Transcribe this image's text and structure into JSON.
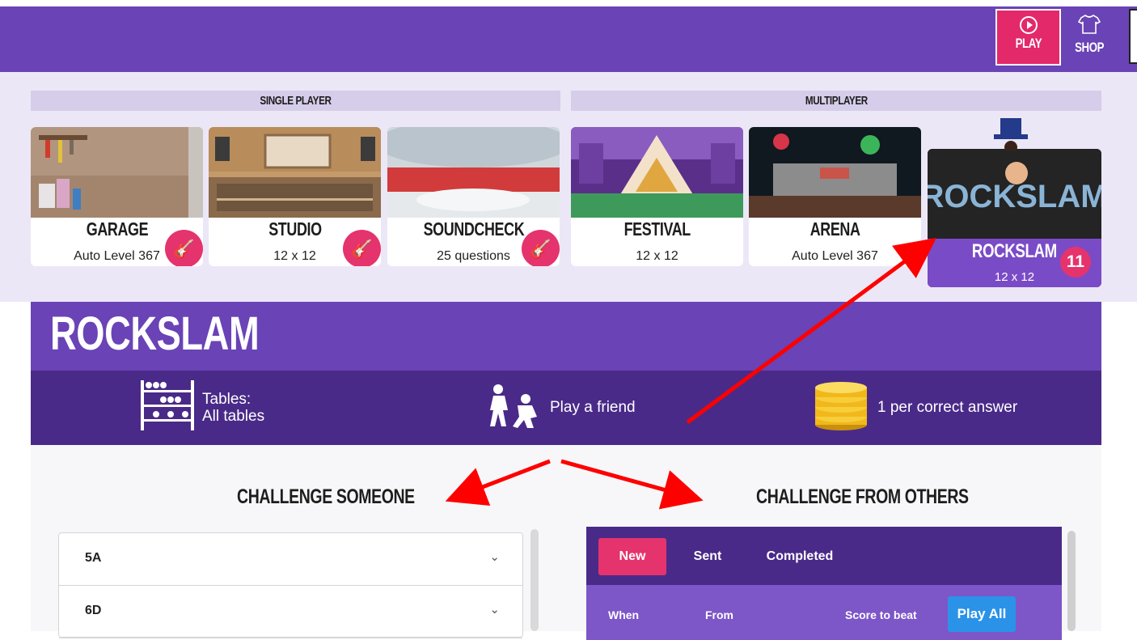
{
  "topbar": {
    "play_label": "PLAY",
    "shop_label": "SHOP",
    "bg_color": "#6a43b6",
    "play_color": "#e3296a"
  },
  "sections": {
    "single_player": "SINGLE PLAYER",
    "multiplayer": "MULTIPLAYER"
  },
  "modes": [
    {
      "name": "GARAGE",
      "sub": "Auto Level 367",
      "icon": "guitar-icon"
    },
    {
      "name": "STUDIO",
      "sub": "12 x 12",
      "icon": "guitar-icon"
    },
    {
      "name": "SOUNDCHECK",
      "sub": "25 questions",
      "icon": "guitar-icon"
    },
    {
      "name": "FESTIVAL",
      "sub": "12 x 12"
    },
    {
      "name": "ARENA",
      "sub": "Auto Level 367"
    }
  ],
  "rockslam_card": {
    "name": "ROCKSLAM",
    "sub": "12 x 12",
    "count": "11",
    "logo_text": "ROCKSLAM"
  },
  "rockslam": {
    "title": "ROCKSLAM",
    "tables_label": "Tables:",
    "tables_value": "All tables",
    "mode_label": "Play a friend",
    "reward_label": "1 per correct answer"
  },
  "challenge_someone": {
    "title": "CHALLENGE SOMEONE",
    "classes": [
      "5A",
      "6D"
    ]
  },
  "challenge_from_others": {
    "title": "CHALLENGE FROM OTHERS",
    "tabs": [
      "New",
      "Sent",
      "Completed"
    ],
    "columns": [
      "When",
      "From",
      "Score to beat"
    ],
    "play_all_label": "Play All"
  },
  "colors": {
    "accent_pink": "#e5336d",
    "purple_dark": "#4a2a88",
    "purple_mid": "#7d56c8",
    "blue_button": "#2a93e8"
  }
}
